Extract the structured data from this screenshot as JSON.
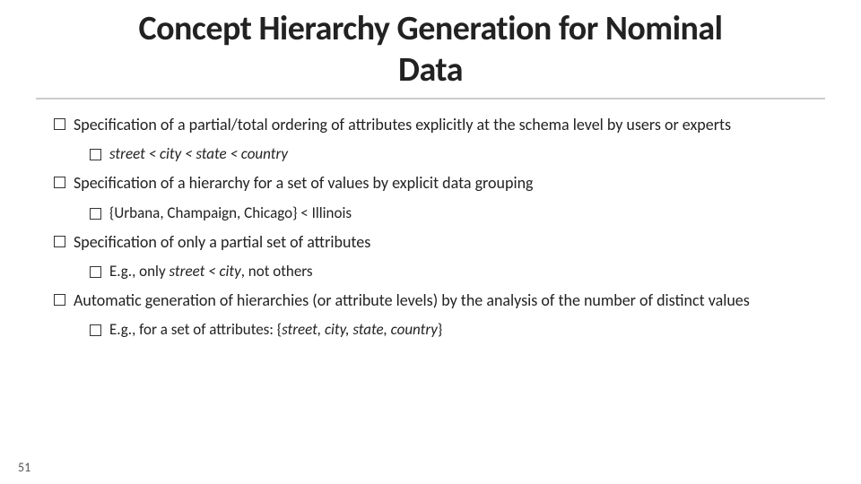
{
  "slide": {
    "title_line1": "Concept Hierarchy Generation for Nominal",
    "title_line2": "Data",
    "slide_number": "51",
    "bullets": [
      {
        "id": "bullet1",
        "text": "Specification of a partial/total ordering of attributes explicitly at the schema level by users or experts",
        "sub_bullets": [
          {
            "id": "sub1a",
            "text_parts": [
              {
                "type": "italic",
                "content": "street < city < state < country"
              }
            ]
          }
        ]
      },
      {
        "id": "bullet2",
        "text": "Specification of a hierarchy for a set of values by explicit data grouping",
        "sub_bullets": [
          {
            "id": "sub2a",
            "text": "{Urbana, Champaign, Chicago} < Illinois"
          }
        ]
      },
      {
        "id": "bullet3",
        "text": "Specification of only a partial set of attributes",
        "sub_bullets": [
          {
            "id": "sub3a",
            "text_prefix": "E.g., only ",
            "text_italic": "street < city",
            "text_suffix": ", not others"
          }
        ]
      },
      {
        "id": "bullet4",
        "text": "Automatic generation of hierarchies (or attribute levels) by the analysis of the number of distinct values",
        "sub_bullets": [
          {
            "id": "sub4a",
            "text_prefix": "E.g., for a set of attributes: {",
            "text_italic": "street, city, state, country",
            "text_suffix": "}"
          }
        ]
      }
    ]
  }
}
